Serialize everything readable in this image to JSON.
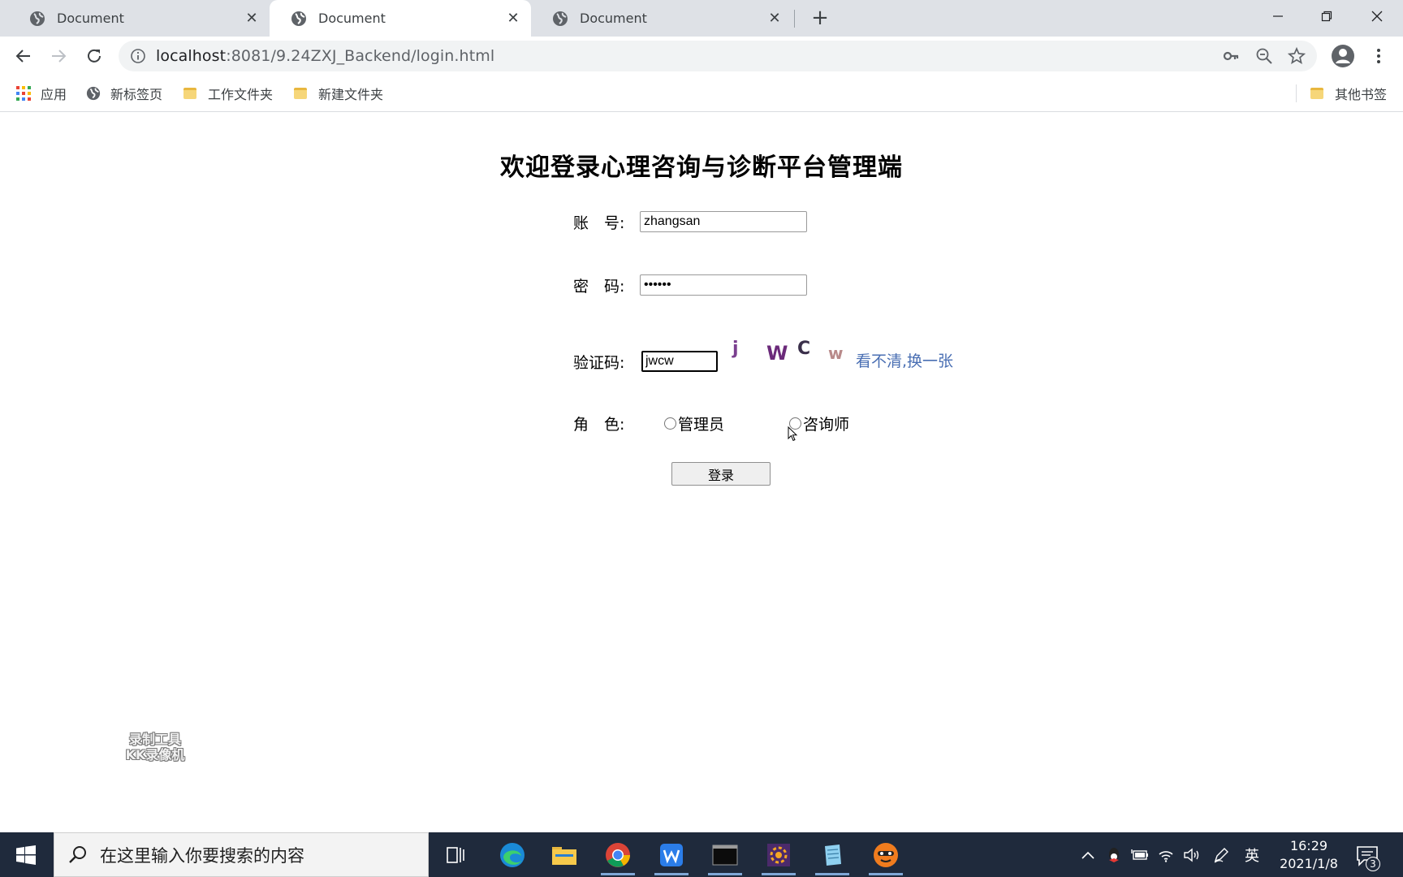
{
  "browser": {
    "tabs": [
      {
        "title": "Document",
        "active": false
      },
      {
        "title": "Document",
        "active": true
      },
      {
        "title": "Document",
        "active": false
      }
    ],
    "url_host": "localhost",
    "url_rest": ":8081/9.24ZXJ_Backend/login.html",
    "bookmarks": [
      {
        "label": "应用",
        "icon": "apps-grid-icon"
      },
      {
        "label": "新标签页",
        "icon": "globe-icon"
      },
      {
        "label": "工作文件夹",
        "icon": "folder-icon"
      },
      {
        "label": "新建文件夹",
        "icon": "folder-icon"
      }
    ],
    "other_bookmarks": "其他书签"
  },
  "page": {
    "title": "欢迎登录心理咨询与诊断平台管理端",
    "account_label": "账　号:",
    "account_value": "zhangsan",
    "password_label": "密　码:",
    "password_value": "123456",
    "captcha_label": "验证码:",
    "captcha_value": "jwcw",
    "captcha_chars": [
      {
        "char": "j",
        "color": "#7b3f8f"
      },
      {
        "char": "W",
        "color": "#6b2a7a"
      },
      {
        "char": "C",
        "color": "#3a2f4a"
      },
      {
        "char": "w",
        "color": "#b88a8a"
      }
    ],
    "captcha_refresh": "看不清,换一张",
    "role_label": "角　色:",
    "role_options": [
      "管理员",
      "咨询师"
    ],
    "login_button": "登录",
    "watermark_line1": "录制工具",
    "watermark_line2": "KK录像机"
  },
  "taskbar": {
    "search_placeholder": "在这里输入你要搜索的内容",
    "ime": "英",
    "time": "16:29",
    "date": "2021/1/8",
    "notification_count": "3"
  },
  "colors": {
    "tabstrip_bg": "#dee1e6",
    "link": "#4a6fb3",
    "taskbar_bg": "#1f2a3c"
  }
}
